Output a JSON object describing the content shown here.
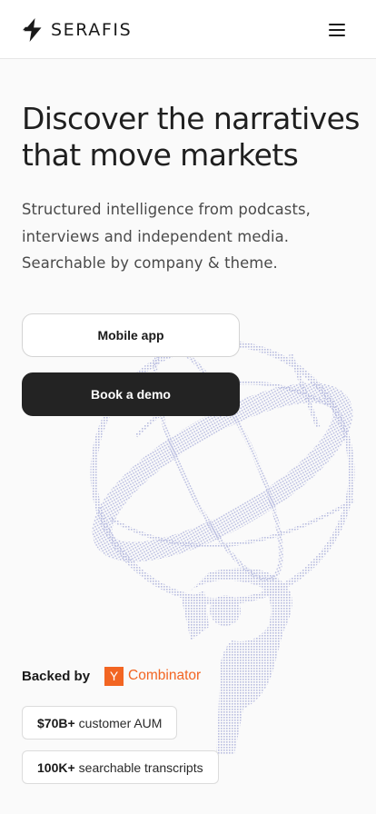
{
  "header": {
    "brand": "SERAFIS",
    "logo_icon": "lightning-bolt-icon",
    "menu_icon": "hamburger-menu-icon"
  },
  "hero": {
    "headline_line1": "Discover the narratives",
    "headline_line2": "that move markets",
    "subtitle_line1": "Structured intelligence from podcasts,",
    "subtitle_line2": "interviews and independent media.",
    "subtitle_line3": "Searchable by company & theme."
  },
  "buttons": {
    "mobile_app": "Mobile app",
    "book_demo": "Book a demo"
  },
  "backing": {
    "label": "Backed by",
    "yc_letter": "Y",
    "yc_name": "Combinator",
    "accent": "#f26522"
  },
  "stats": [
    {
      "value": "$70B+",
      "label": "customer AUM"
    },
    {
      "value": "100K+",
      "label": "searchable transcripts"
    }
  ],
  "colors": {
    "background": "#fafafa",
    "dark_button": "#232323",
    "illustration": "#c9cbe6"
  }
}
